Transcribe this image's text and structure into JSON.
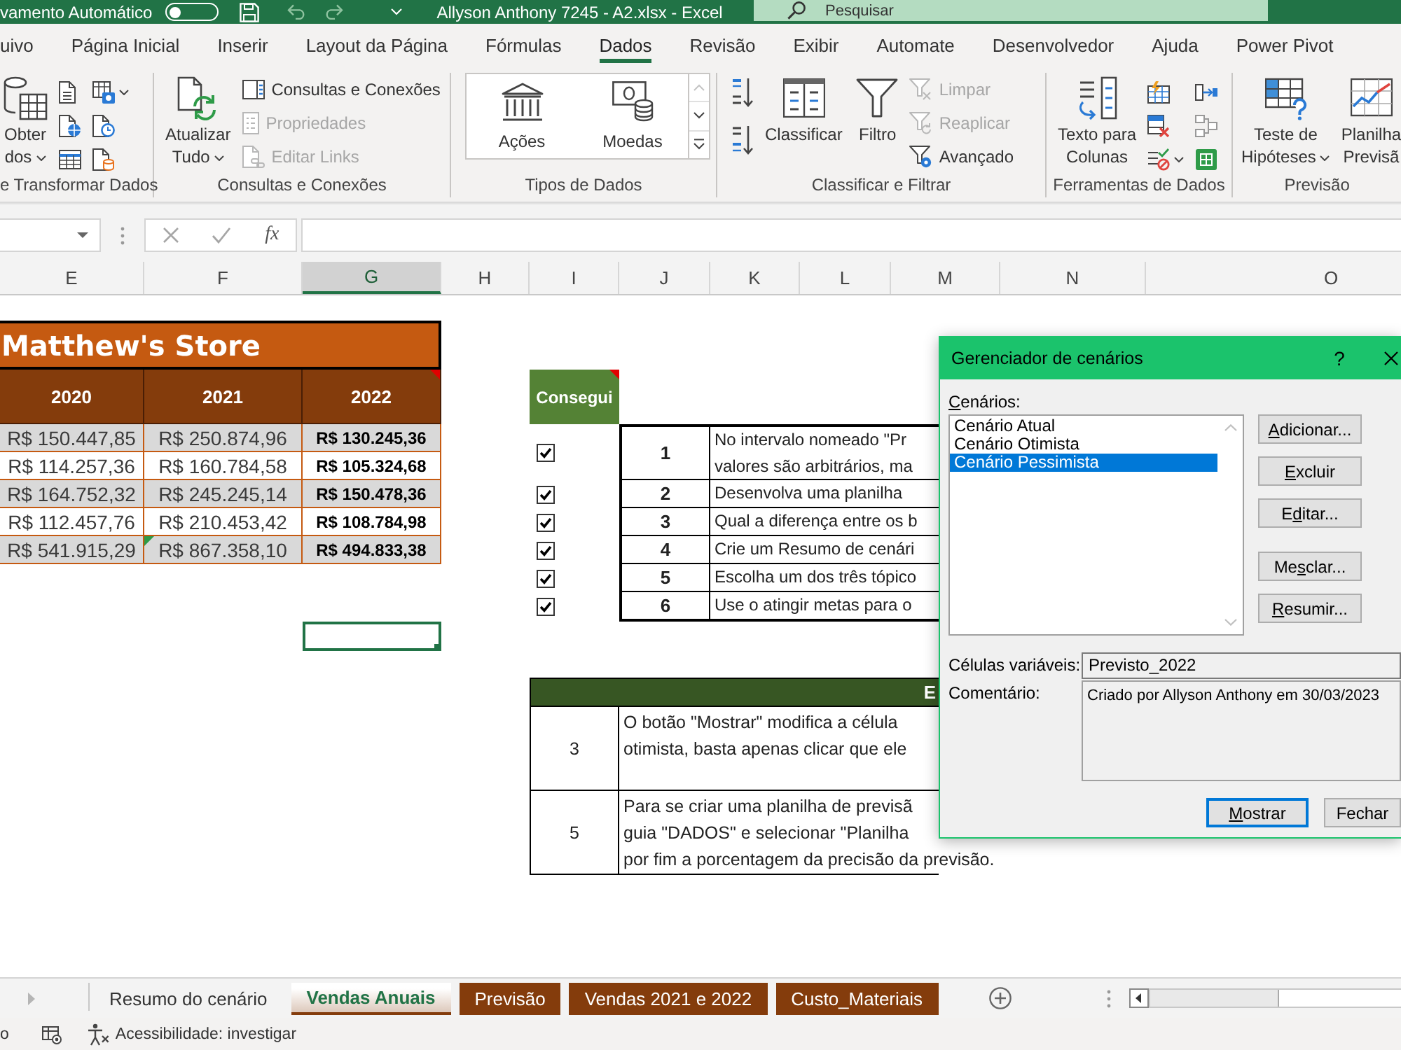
{
  "title_bar": {
    "autosave_label": "vamento Automático",
    "autosave_on": false,
    "document_title": "Allyson Anthony 7245 - A2.xlsx - Excel",
    "search": {
      "placeholder": "Pesquisar"
    }
  },
  "menu_tabs": [
    {
      "label": "uivo",
      "selected": false
    },
    {
      "label": "Página Inicial",
      "selected": false
    },
    {
      "label": "Inserir",
      "selected": false
    },
    {
      "label": "Layout da Página",
      "selected": false
    },
    {
      "label": "Fórmulas",
      "selected": false
    },
    {
      "label": "Dados",
      "selected": true
    },
    {
      "label": "Revisão",
      "selected": false
    },
    {
      "label": "Exibir",
      "selected": false
    },
    {
      "label": "Automate",
      "selected": false
    },
    {
      "label": "Desenvolvedor",
      "selected": false
    },
    {
      "label": "Ajuda",
      "selected": false
    },
    {
      "label": "Power Pivot",
      "selected": false
    }
  ],
  "ribbon": {
    "groups": [
      {
        "label": "e Transformar Dados",
        "items": [
          {
            "kind": "large",
            "lines": [
              "Obter",
              "dos"
            ],
            "menu": true
          },
          {
            "kind": "icon",
            "menu": false
          },
          {
            "kind": "icon",
            "menu": false
          },
          {
            "kind": "icon",
            "menu": false
          },
          {
            "kind": "icon",
            "menu": true
          },
          {
            "kind": "icon",
            "menu": false
          },
          {
            "kind": "icon",
            "menu": false
          }
        ]
      },
      {
        "label": "Consultas e Conexões",
        "items": [
          {
            "kind": "large",
            "lines": [
              "Atualizar",
              "Tudo"
            ],
            "menu": true
          },
          {
            "kind": "small",
            "label": "Consultas e Conexões",
            "disabled": false
          },
          {
            "kind": "small",
            "label": "Propriedades",
            "disabled": true
          },
          {
            "kind": "small",
            "label": "Editar Links",
            "disabled": true
          }
        ]
      },
      {
        "label": "Tipos de Dados",
        "items": [
          {
            "kind": "gallery",
            "entries": [
              "Ações",
              "Moedas"
            ]
          }
        ]
      },
      {
        "label": "Classificar e Filtrar",
        "items": [
          {
            "kind": "icon",
            "menu": false
          },
          {
            "kind": "icon",
            "menu": false
          },
          {
            "kind": "large",
            "lines": [
              "Classificar"
            ],
            "menu": false
          },
          {
            "kind": "large",
            "lines": [
              "Filtro"
            ],
            "menu": false
          },
          {
            "kind": "small",
            "label": "Limpar",
            "disabled": true
          },
          {
            "kind": "small",
            "label": "Reaplicar",
            "disabled": true
          },
          {
            "kind": "small",
            "label": "Avançado",
            "disabled": false
          }
        ]
      },
      {
        "label": "Ferramentas de Dados",
        "items": [
          {
            "kind": "large",
            "lines": [
              "Texto para",
              "Colunas"
            ],
            "menu": false
          },
          {
            "kind": "icon",
            "menu": false
          },
          {
            "kind": "icon",
            "menu": false
          },
          {
            "kind": "icon",
            "menu": true
          },
          {
            "kind": "icon",
            "menu": false
          },
          {
            "kind": "icon",
            "menu": false
          },
          {
            "kind": "icon",
            "menu": false
          }
        ]
      },
      {
        "label": "Previsão",
        "items": [
          {
            "kind": "large",
            "lines": [
              "Teste de",
              "Hipóteses"
            ],
            "menu": true
          },
          {
            "kind": "large",
            "lines": [
              "Planilha",
              "Previsã"
            ],
            "menu": false
          }
        ]
      }
    ]
  },
  "formula_bar": {
    "insert_function": "fx"
  },
  "sheet": {
    "columns": [
      {
        "label": "E",
        "selected": false
      },
      {
        "label": "F",
        "selected": false
      },
      {
        "label": "G",
        "selected": true
      },
      {
        "label": "H",
        "selected": false
      },
      {
        "label": "I",
        "selected": false
      },
      {
        "label": "J",
        "selected": false
      },
      {
        "label": "K",
        "selected": false
      },
      {
        "label": "L",
        "selected": false
      },
      {
        "label": "M",
        "selected": false
      },
      {
        "label": "N",
        "selected": false
      },
      {
        "label": "O",
        "selected": false
      }
    ],
    "store_table": {
      "title": "Matthew's Store",
      "headers": [
        {
          "label": "2020",
          "note": false
        },
        {
          "label": "2021",
          "note": false
        },
        {
          "label": "2022",
          "note": true
        }
      ],
      "rows": [
        {
          "cells": [
            {
              "value": "R$ 150.447,85",
              "warning": false
            },
            {
              "value": "R$ 250.874,96",
              "warning": false
            },
            {
              "value": "R$ 130.245,36",
              "warning": false
            }
          ]
        },
        {
          "cells": [
            {
              "value": "R$ 114.257,36",
              "warning": false
            },
            {
              "value": "R$ 160.784,58",
              "warning": false
            },
            {
              "value": "R$ 105.324,68",
              "warning": false
            }
          ]
        },
        {
          "cells": [
            {
              "value": "R$ 164.752,32",
              "warning": false
            },
            {
              "value": "R$ 245.245,14",
              "warning": false
            },
            {
              "value": "R$ 150.478,36",
              "warning": false
            }
          ]
        },
        {
          "cells": [
            {
              "value": "R$ 112.457,76",
              "warning": false
            },
            {
              "value": "R$ 210.453,42",
              "warning": false
            },
            {
              "value": "R$ 108.784,98",
              "warning": false
            }
          ]
        },
        {
          "cells": [
            {
              "value": "R$ 541.915,29",
              "warning": false
            },
            {
              "value": "R$ 867.358,10",
              "warning": true
            },
            {
              "value": "R$ 494.833,38",
              "warning": false
            }
          ]
        }
      ]
    },
    "checklist": {
      "header": "Consegui",
      "note": true,
      "tasks": [
        {
          "checked": true,
          "number": "1",
          "lines": [
            "No intervalo nomeado \"Pr",
            "valores são arbitrários, ma"
          ]
        },
        {
          "checked": true,
          "number": "2",
          "lines": [
            "Desenvolva uma planilha"
          ]
        },
        {
          "checked": true,
          "number": "3",
          "lines": [
            "Qual a diferença entre os b"
          ]
        },
        {
          "checked": true,
          "number": "4",
          "lines": [
            "Crie um Resumo de cenári"
          ]
        },
        {
          "checked": true,
          "number": "5",
          "lines": [
            "Escolha um dos três tópico"
          ]
        },
        {
          "checked": true,
          "number": "6",
          "lines": [
            "Use o atingir metas para o"
          ]
        }
      ]
    },
    "explanations": {
      "header": "E",
      "rows": [
        {
          "number": "3",
          "lines": [
            "O botão \"Mostrar\" modifica a célula",
            "otimista, basta apenas clicar que ele"
          ]
        },
        {
          "number": "5",
          "lines": [
            "Para se criar uma planilha de previsã",
            "guia \"DADOS\" e selecionar \"Planilha",
            "por fim a porcentagem da precisão da previsão."
          ]
        }
      ]
    }
  },
  "scenario_dialog": {
    "title": "Gerenciador de cenários",
    "help": "?",
    "list_label": [
      {
        "text": "C",
        "access_key": true
      },
      {
        "text": "enários:",
        "access_key": false
      }
    ],
    "scenarios": [
      {
        "label": "Cenário Atual",
        "selected": false
      },
      {
        "label": "Cenário Otimista",
        "selected": false
      },
      {
        "label": "Cenário Pessimista",
        "selected": true
      }
    ],
    "side_buttons": [
      {
        "label": [
          {
            "text": "A",
            "access_key": true
          },
          {
            "text": "dicionar...",
            "access_key": false
          }
        ]
      },
      {
        "label": [
          {
            "text": "E",
            "access_key": true
          },
          {
            "text": "xcluir",
            "access_key": false
          }
        ]
      },
      {
        "label": [
          {
            "text": "E",
            "access_key": false
          },
          {
            "text": "d",
            "access_key": true
          },
          {
            "text": "itar...",
            "access_key": false
          }
        ]
      },
      {
        "label": [
          {
            "text": "Me",
            "access_key": false
          },
          {
            "text": "s",
            "access_key": true
          },
          {
            "text": "clar...",
            "access_key": false
          }
        ]
      },
      {
        "label": [
          {
            "text": "R",
            "access_key": true
          },
          {
            "text": "esumir...",
            "access_key": false
          }
        ]
      }
    ],
    "changing_cells_label": "Células variáveis:",
    "changing_cells": "Previsto_2022",
    "comment_label": "Comentário:",
    "comment": "Criado por Allyson Anthony em 30/03/2023",
    "footer_buttons": [
      {
        "label": [
          {
            "text": "M",
            "access_key": true
          },
          {
            "text": "ostrar",
            "access_key": false
          }
        ],
        "default": true
      },
      {
        "label": [
          {
            "text": "Fechar",
            "access_key": false
          }
        ],
        "default": false
      }
    ]
  },
  "sheet_tabs": [
    {
      "label": "Resumo do cenário",
      "selected": false
    },
    {
      "label": "Vendas Anuais",
      "selected": true,
      "color": "#843c0c"
    },
    {
      "label": "Previsão",
      "selected": false,
      "color": "#843c0c"
    },
    {
      "label": "Vendas 2021 e 2022",
      "selected": false,
      "color": "#843c0c"
    },
    {
      "label": "Custo_Materiais",
      "selected": false,
      "color": "#843c0c"
    }
  ],
  "status_bar": {
    "mode": "o",
    "accessibility": "Acessibilidade: investigar"
  }
}
